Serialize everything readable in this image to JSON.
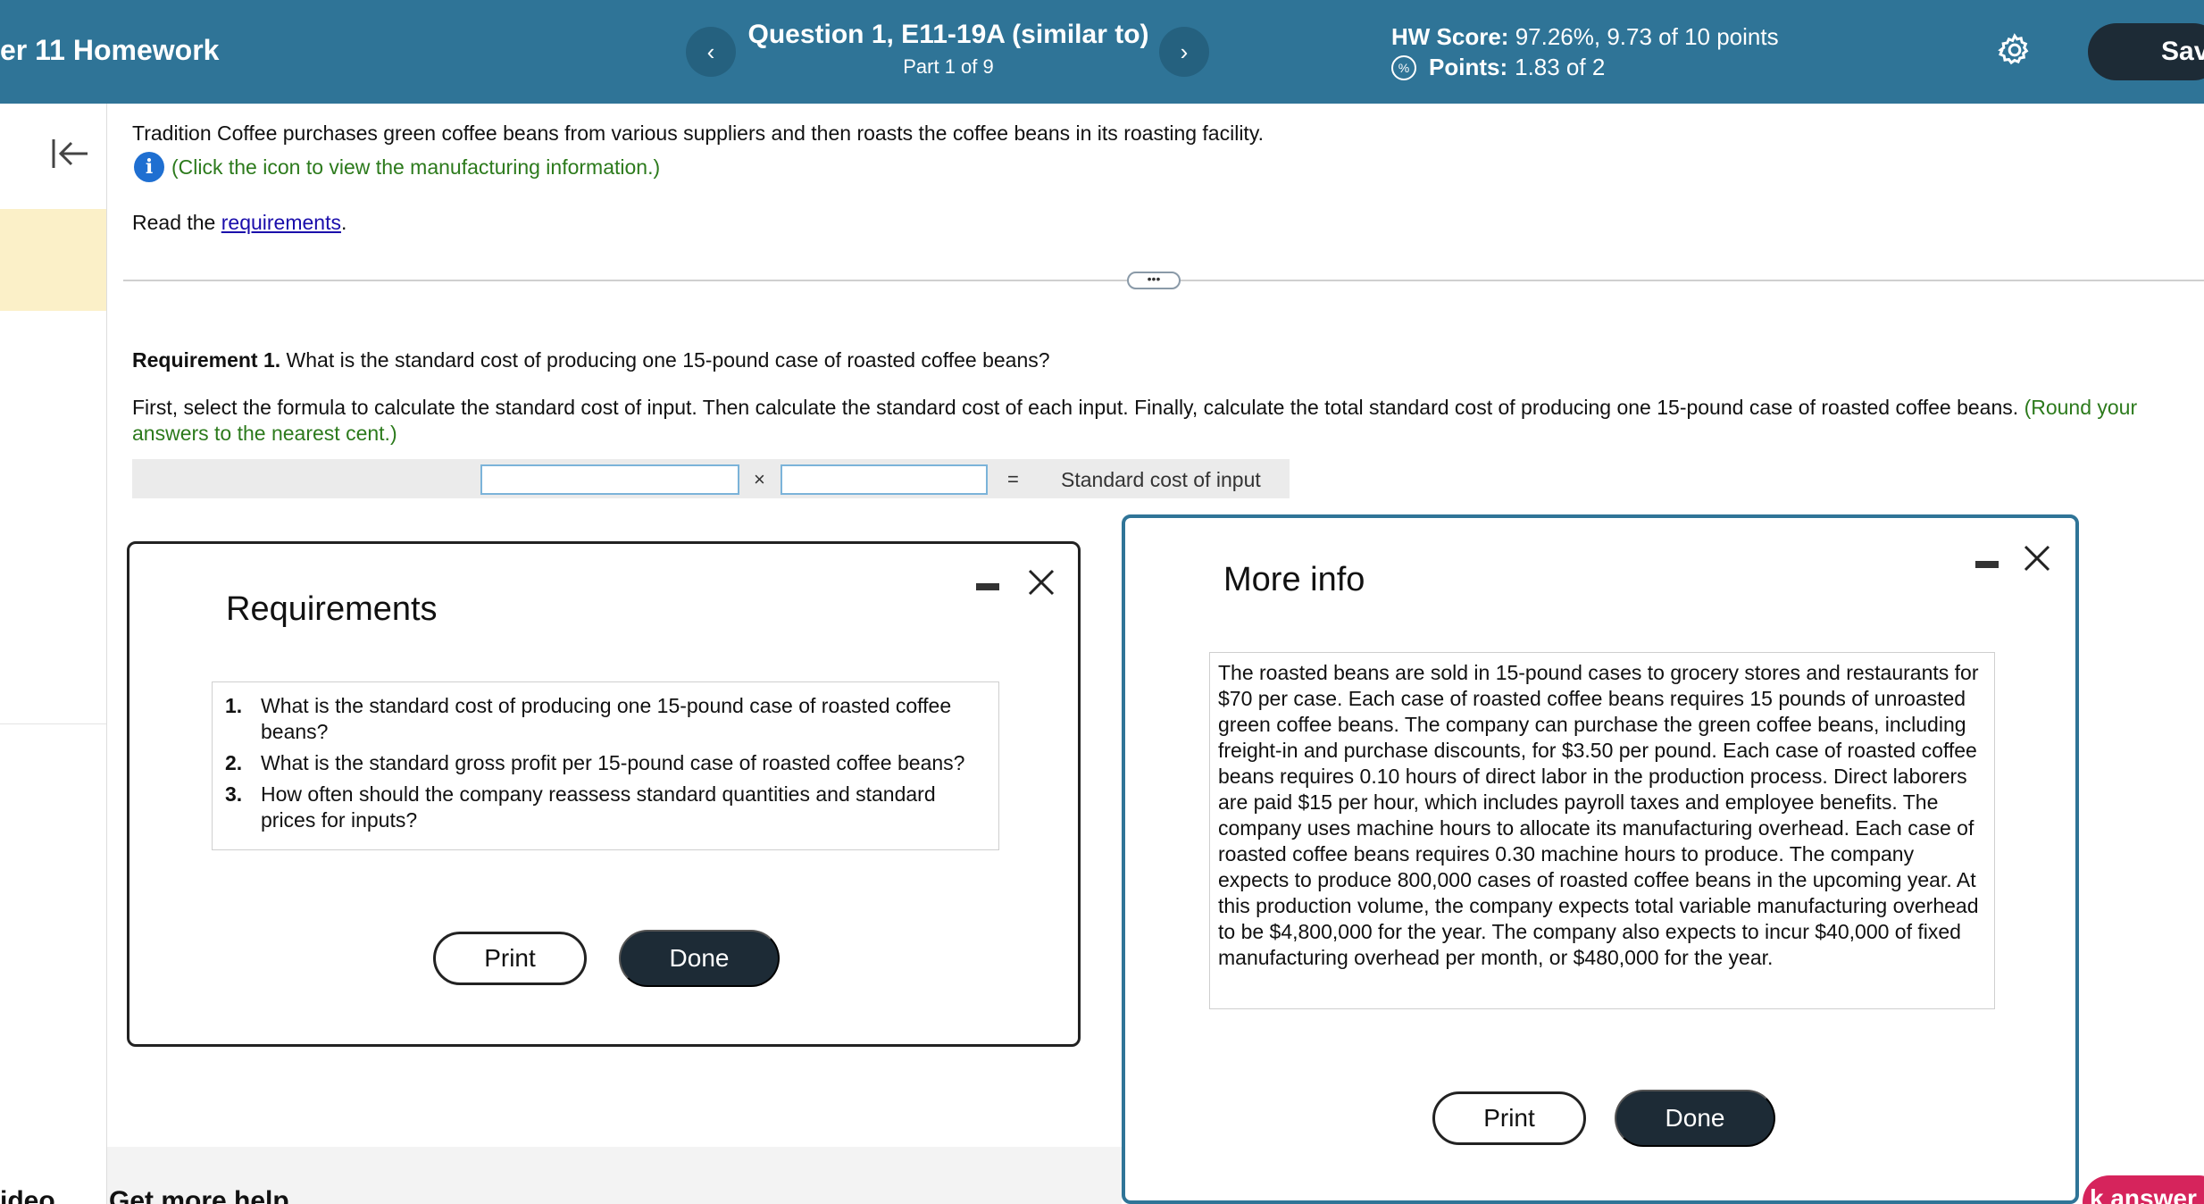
{
  "header": {
    "title": "er 11 Homework",
    "prev_icon": "chevron-left-icon",
    "next_icon": "chevron-right-icon",
    "question_title": "Question 1, E11-19A (similar to)",
    "question_part": "Part 1 of 9",
    "hw_score_label": "HW Score:",
    "hw_score_value": "97.26%, 9.73 of 10 points",
    "points_label": "Points:",
    "points_value": "1.83 of 2",
    "save_label": "Save",
    "bg_color": "#2f7497"
  },
  "problem": {
    "intro": "Tradition Coffee purchases green coffee beans from various suppliers and then roasts the coffee beans in its roasting facility.",
    "info_link": "(Click the icon to view the manufacturing information.)",
    "read_prefix": "Read the ",
    "read_link": "requirements",
    "read_suffix": "."
  },
  "requirement1": {
    "label": "Requirement 1.",
    "question": "What is the standard cost of producing one 15-pound case of roasted coffee beans?",
    "instructions": "First, select the formula to calculate the standard cost of input. Then calculate the standard cost of each input. Finally, calculate the total standard cost of producing one 15-pound case of roasted coffee beans.",
    "hint": "(Round your answers to the nearest cent.)",
    "formula": {
      "operator_times": "×",
      "operator_equals": "=",
      "result_label": "Standard cost of input",
      "input1_value": "",
      "input2_value": ""
    }
  },
  "requirements_modal": {
    "title": "Requirements",
    "items": [
      {
        "num": "1.",
        "text": "What is the standard cost of producing one 15-pound case of roasted coffee beans?"
      },
      {
        "num": "2.",
        "text": "What is the standard gross profit per 15-pound case of roasted coffee beans?"
      },
      {
        "num": "3.",
        "text": "How often should the company reassess standard quantities and standard prices for inputs?"
      }
    ],
    "print_label": "Print",
    "done_label": "Done"
  },
  "info_modal": {
    "title": "More info",
    "text": "The roasted beans are sold in 15-pound cases to grocery stores and restaurants for $70 per case. Each case of roasted coffee beans requires 15 pounds of unroasted green coffee beans. The company can purchase the green coffee beans, including freight-in and purchase discounts, for $3.50 per pound. Each case of roasted coffee beans requires 0.10 hours of direct labor in the production process. Direct laborers are paid $15 per hour, which includes payroll taxes and employee benefits. The company uses machine hours to allocate its manufacturing overhead. Each case of roasted coffee beans requires 0.30 machine hours to produce. The company expects to produce 800,000 cases of roasted coffee beans in the upcoming year. At this production volume, the company expects total variable manufacturing overhead to be $4,800,000 for the year. The company also expects to incur $40,000 of fixed manufacturing overhead per month, or $480,000 for the year.",
    "print_label": "Print",
    "done_label": "Done"
  },
  "bottom": {
    "left_label": "ideo",
    "help_label": "Get more help",
    "check_answer_label": "k answer"
  }
}
